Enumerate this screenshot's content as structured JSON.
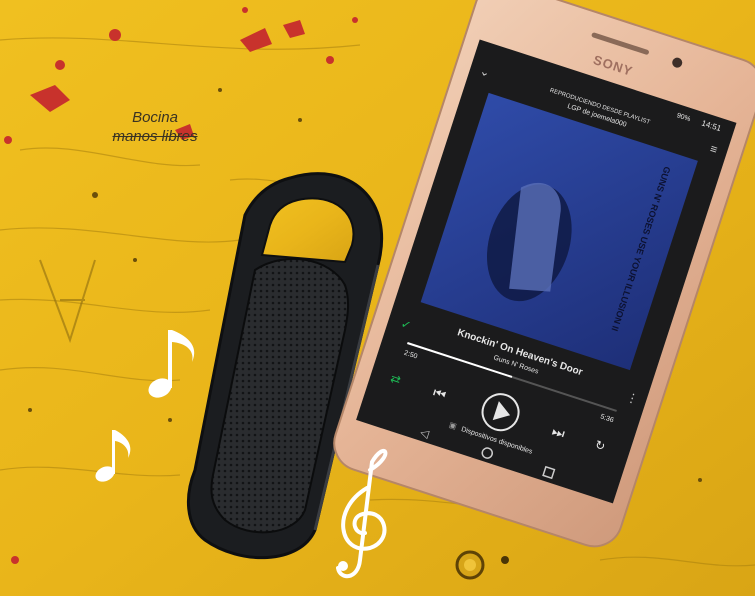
{
  "caption": {
    "line1": "Bocina",
    "line2": "manos libres"
  },
  "phone": {
    "brand": "SONY",
    "status_time": "14:51",
    "battery": "90%",
    "playlist_header_line1": "REPRODUCIENDO DESDE PLAYLIST",
    "playlist_header_line2": "LGP de joemela000",
    "album_art_text": "GUNS N' ROSES USE YOUR ILLUSION II",
    "track_title": "Knockin' On Heaven's Door",
    "track_artist": "Guns N' Roses",
    "elapsed": "2:50",
    "duration": "5:36",
    "devices_label": "Dispositivos disponibles"
  },
  "colors": {
    "table_yellow": "#e8b51a",
    "paint_red": "#c8322c",
    "phone_gold": "#e7b99c",
    "screen_dark": "#1b1b1c",
    "speaker_black": "#1d1f22",
    "note_white": "#ffffff"
  },
  "decorations": [
    "music-note-icon",
    "music-note-icon",
    "treble-clef-icon"
  ]
}
